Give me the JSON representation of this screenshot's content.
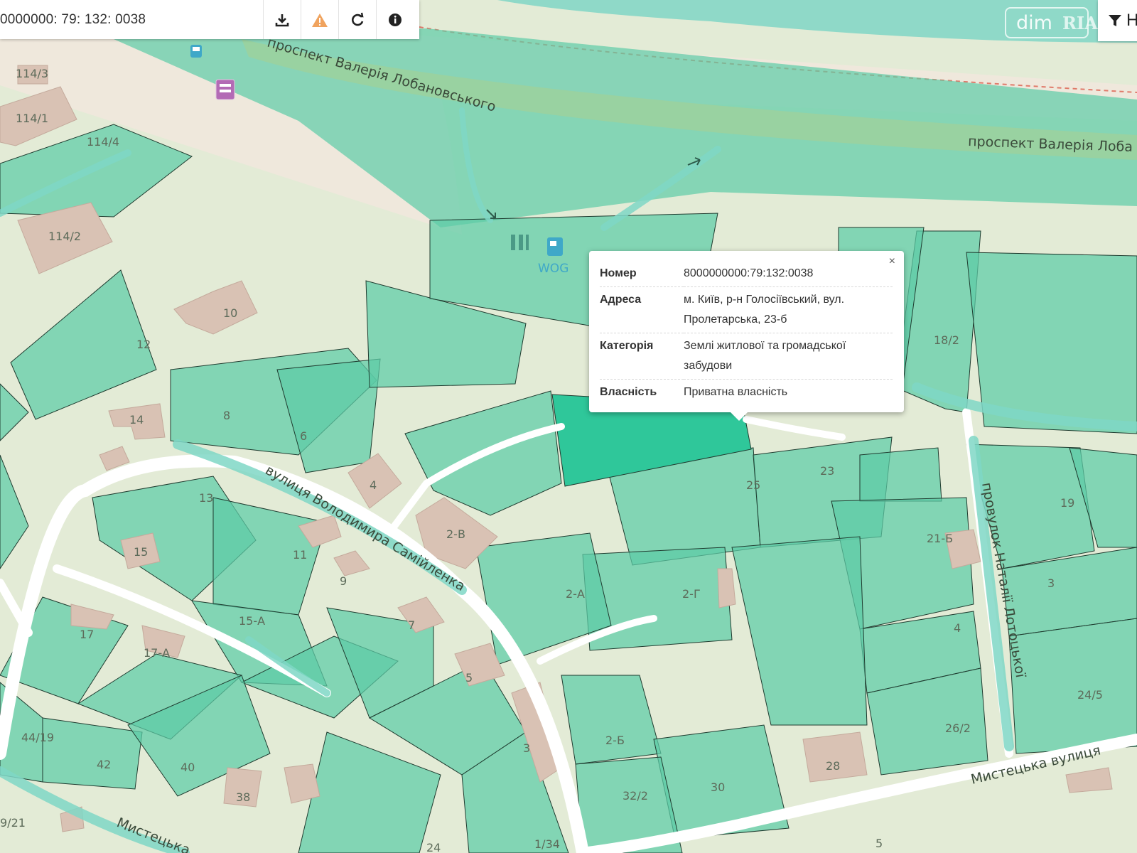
{
  "toolbar": {
    "cadastral_number": "0000000: 79: 132: 0038",
    "buttons": [
      {
        "name": "download-icon"
      },
      {
        "name": "warning-icon"
      },
      {
        "name": "refresh-icon"
      },
      {
        "name": "info-icon"
      }
    ]
  },
  "watermark": {
    "text": "dim",
    "brand": "RIA"
  },
  "filter": {
    "label": "Н",
    "icon": "filter-icon"
  },
  "popup": {
    "close": "×",
    "rows": [
      {
        "key": "Номер",
        "value": "8000000000:79:132:0038"
      },
      {
        "key": "Адреса",
        "value": "м. Київ, р-н Голосіївський, вул. Пролетарська, 23-б"
      },
      {
        "key": "Категорія",
        "value": "Землі житлової та громадської забудови"
      },
      {
        "key": "Власність",
        "value": "Приватна власність"
      }
    ]
  },
  "map": {
    "streets": {
      "lobanovskoho_1": "проспект Валерія Лобановського",
      "lobanovskoho_2": "проспект Валерія Лоба",
      "samiylenka": "вулиця Володимира Самійленка",
      "lototskoi": "провулок Наталії Лотоцької",
      "mystetska_1": "Мистецька вулиця",
      "mystetska_2": "Мистецька"
    },
    "poi": {
      "fuel": "WOG"
    },
    "labels": [
      "114/3",
      "114/1",
      "114/4",
      "114/2",
      "10",
      "12",
      "8",
      "6",
      "14",
      "4",
      "13",
      "15",
      "11",
      "9",
      "2-В",
      "2-А",
      "2-Г",
      "15-А",
      "7",
      "17",
      "17-А",
      "5",
      "44/19",
      "42",
      "40",
      "38",
      "3",
      "2-Б",
      "32/2",
      "30",
      "28",
      "25",
      "23",
      "19",
      "18/2",
      "21-Б",
      "4",
      "3",
      "24/5",
      "26/2",
      "9/21",
      "24",
      "1/34",
      "5"
    ],
    "colors": {
      "parcel": "#5dcca6",
      "selected": "#2fc79a",
      "building": "#d9c2b4",
      "water": "#6ed4c4",
      "background": "#e3ebd6"
    }
  }
}
